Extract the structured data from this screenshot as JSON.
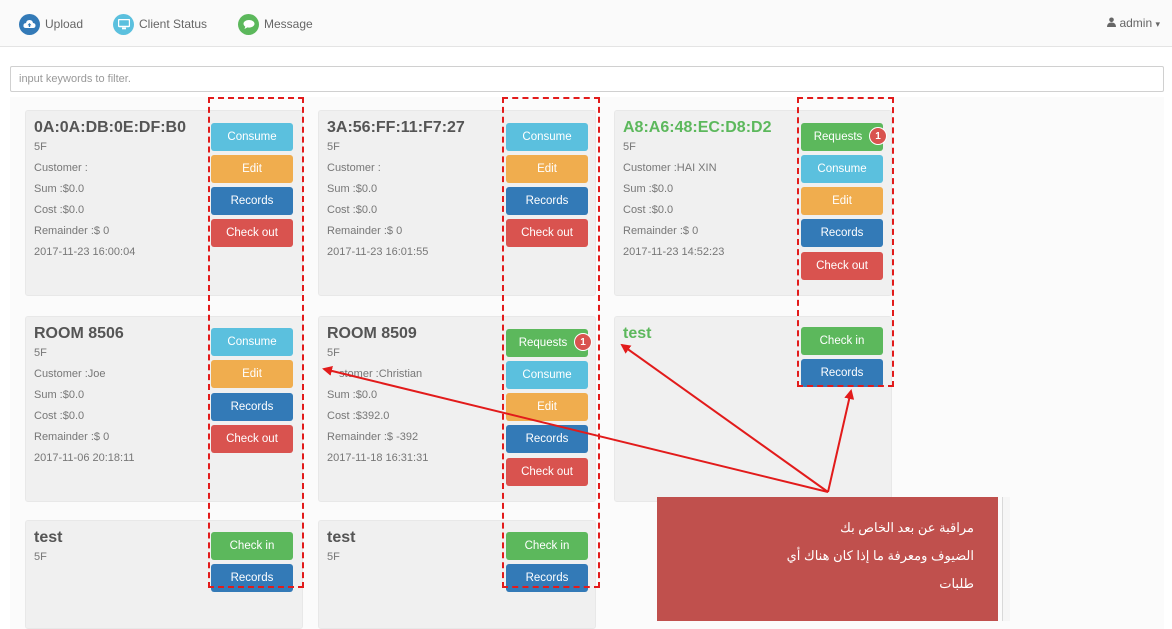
{
  "nav": {
    "upload": "Upload",
    "client_status": "Client Status",
    "message": "Message",
    "user": "admin",
    "user_caret": "▾"
  },
  "filter": {
    "placeholder": "input keywords to filter."
  },
  "cards": [
    {
      "title": "0A:0A:DB:0E:DF:B0",
      "floor": "5F",
      "customer": "Customer :",
      "sum": "Sum :$0.0",
      "cost": "Cost :$0.0",
      "remainder": "Remainder :$ 0",
      "timestamp": "2017-11-23 16:00:04",
      "buttons": [
        "Consume",
        "Edit",
        "Records",
        "Check out"
      ]
    },
    {
      "title": "3A:56:FF:11:F7:27",
      "floor": "5F",
      "customer": "Customer :",
      "sum": "Sum :$0.0",
      "cost": "Cost :$0.0",
      "remainder": "Remainder :$ 0",
      "timestamp": "2017-11-23 16:01:55",
      "buttons": [
        "Consume",
        "Edit",
        "Records",
        "Check out"
      ]
    },
    {
      "title": "A8:A6:48:EC:D8:D2",
      "floor": "5F",
      "customer": "Customer :HAI XIN",
      "sum": "Sum :$0.0",
      "cost": "Cost :$0.0",
      "remainder": "Remainder :$ 0",
      "timestamp": "2017-11-23 14:52:23",
      "buttons": [
        "Requests",
        "Consume",
        "Edit",
        "Records",
        "Check out"
      ],
      "badge": "1"
    },
    {
      "title": "ROOM 8506",
      "floor": "5F",
      "customer": "Customer :Joe",
      "sum": "Sum :$0.0",
      "cost": "Cost :$0.0",
      "remainder": "Remainder :$ 0",
      "timestamp": "2017-11-06 20:18:11",
      "buttons": [
        "Consume",
        "Edit",
        "Records",
        "Check out"
      ]
    },
    {
      "title": "ROOM 8509",
      "floor": "5F",
      "customer": "stomer :Christian",
      "sum": "Sum :$0.0",
      "cost": "Cost :$392.0",
      "remainder": "Remainder :$ -392",
      "timestamp": "2017-11-18 16:31:31",
      "buttons": [
        "Requests",
        "Consume",
        "Edit",
        "Records",
        "Check out"
      ],
      "badge": "1"
    },
    {
      "title": "test",
      "floor": "",
      "buttons": [
        "Check in",
        "Records"
      ]
    },
    {
      "title": "test",
      "floor": "5F",
      "buttons": [
        "Check in",
        "Records"
      ]
    },
    {
      "title": "test",
      "floor": "5F",
      "buttons": [
        "Check in",
        "Records"
      ]
    }
  ],
  "annotation": {
    "lines": [
      "مراقبة عن بعد الخاص بك",
      "الضيوف ومعرفة ما إذا كان هناك أي",
      "طلبات"
    ],
    "color": "#c0504d"
  },
  "colors": {
    "consume": "#5bc0de",
    "edit": "#f0ad4e",
    "records": "#337ab7",
    "checkout": "#d9534f",
    "checkin": "#5cb85c",
    "callout_red": "#e21b1b"
  },
  "icons": {
    "upload": "cloud-upload-icon",
    "client_status": "monitor-icon",
    "message": "chat-bubble-icon",
    "user": "user-icon"
  }
}
